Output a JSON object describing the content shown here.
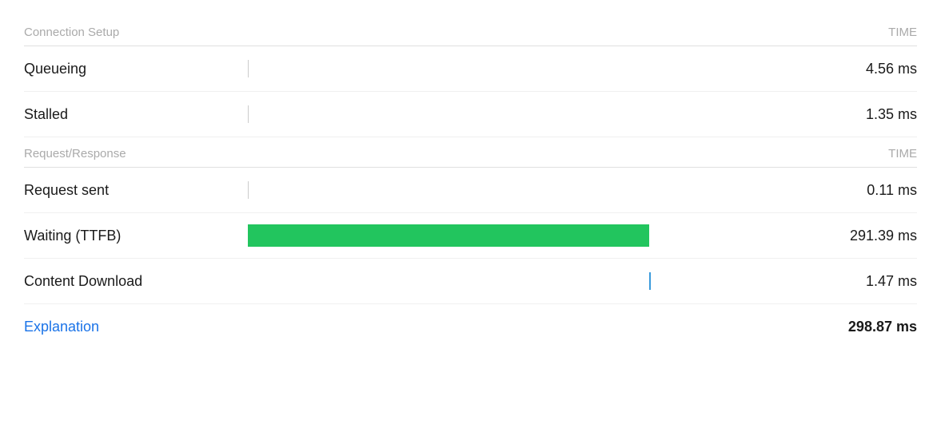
{
  "sections": [
    {
      "id": "connection-setup",
      "label": "Connection Setup",
      "time_label": "TIME",
      "rows": [
        {
          "id": "queueing",
          "label": "Queueing",
          "time": "4.56 ms",
          "bar_type": "tick",
          "bar_color": null,
          "bar_width_pct": 0,
          "bar_left_pct": 0
        },
        {
          "id": "stalled",
          "label": "Stalled",
          "time": "1.35 ms",
          "bar_type": "tick",
          "bar_color": null,
          "bar_width_pct": 0,
          "bar_left_pct": 0
        }
      ]
    },
    {
      "id": "request-response",
      "label": "Request/Response",
      "time_label": "TIME",
      "rows": [
        {
          "id": "request-sent",
          "label": "Request sent",
          "time": "0.11 ms",
          "bar_type": "tick",
          "bar_color": null,
          "bar_width_pct": 0,
          "bar_left_pct": 0
        },
        {
          "id": "waiting-ttfb",
          "label": "Waiting (TTFB)",
          "time": "291.39 ms",
          "bar_type": "green",
          "bar_color": "#22c55e",
          "bar_width_pct": 72,
          "bar_left_pct": 0
        },
        {
          "id": "content-download",
          "label": "Content Download",
          "time": "1.47 ms",
          "bar_type": "blue-tick",
          "bar_color": "#3b9bdc",
          "bar_width_pct": 0,
          "bar_left_pct": 72
        }
      ]
    }
  ],
  "footer": {
    "explanation_label": "Explanation",
    "total_time": "298.87 ms"
  }
}
